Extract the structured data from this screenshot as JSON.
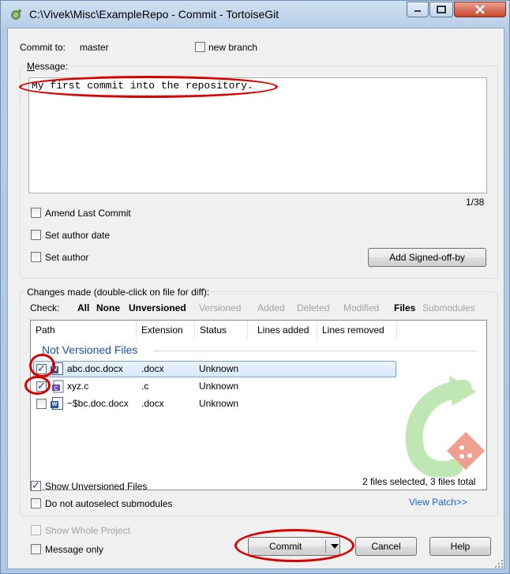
{
  "window": {
    "title": "C:\\Vivek\\Misc\\ExampleRepo - Commit - TortoiseGit"
  },
  "commit_to": {
    "label": "Commit to:",
    "branch": "master"
  },
  "new_branch": {
    "label": "new branch",
    "checked": false
  },
  "message": {
    "label": "Message:",
    "text": "My first commit into the repository.",
    "counter": "1/38"
  },
  "options": {
    "amend": "Amend Last Commit",
    "set_author_date": "Set author date",
    "set_author": "Set author",
    "add_signed_off": "Add Signed-off-by"
  },
  "changes": {
    "label": "Changes made (double-click on file for diff):",
    "check_label": "Check:",
    "filters": [
      "All",
      "None",
      "Unversioned",
      "Versioned",
      "Added",
      "Deleted",
      "Modified",
      "Files",
      "Submodules"
    ],
    "columns": [
      "Path",
      "Extension",
      "Status",
      "Lines added",
      "Lines removed"
    ],
    "group_header": "Not Versioned Files",
    "files": [
      {
        "path": "abc.doc.docx",
        "extension": ".docx",
        "status": "Unknown",
        "checked": true,
        "icon": "word-doc-icon"
      },
      {
        "path": "xyz.c",
        "extension": ".c",
        "status": "Unknown",
        "checked": true,
        "icon": "c-file-icon"
      },
      {
        "path": "~$bc.doc.docx",
        "extension": ".docx",
        "status": "Unknown",
        "checked": false,
        "icon": "word-doc-icon"
      }
    ],
    "selection_summary": "2 files selected, 3 files total"
  },
  "bottom": {
    "show_unversioned": "Show Unversioned Files",
    "no_autoselect": "Do not autoselect submodules",
    "view_patch": "View Patch>>",
    "show_whole_project": "Show Whole Project",
    "message_only": "Message only",
    "commit": "Commit",
    "cancel": "Cancel",
    "help": "Help"
  },
  "colors": {
    "annotation": "#d90000",
    "group_header": "#1e4fa5",
    "link": "#1a66c9"
  }
}
